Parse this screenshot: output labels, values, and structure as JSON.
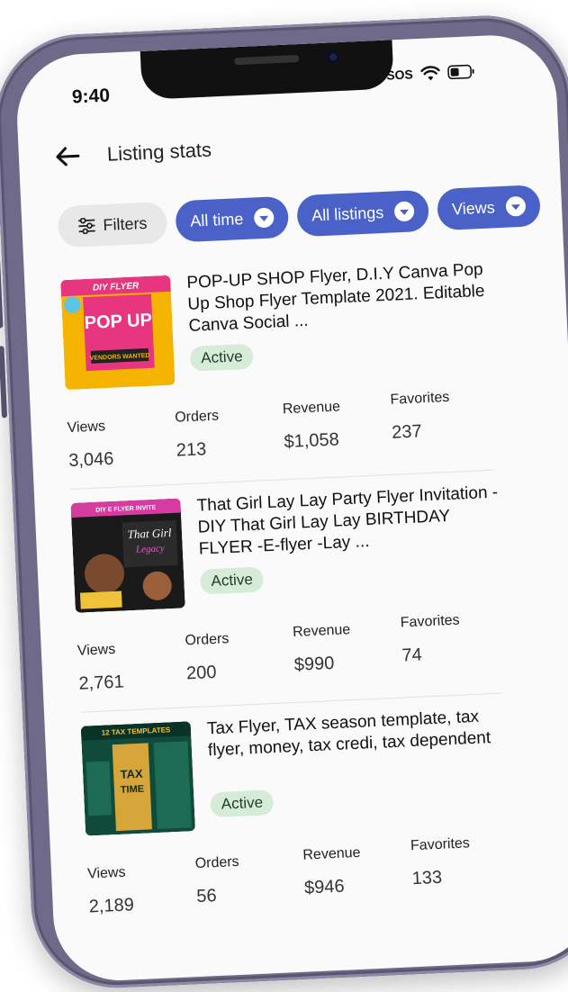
{
  "status_bar": {
    "time": "9:40",
    "carrier": "SOS"
  },
  "header": {
    "title": "Listing stats"
  },
  "chips": {
    "filters": "Filters",
    "time_range": "All time",
    "listings": "All listings",
    "views": "Views"
  },
  "listings": [
    {
      "title": "POP-UP SHOP Flyer, D.I.Y Canva Pop Up Shop Flyer Template 2021. Editable Canva Social ...",
      "status": "Active",
      "stats": {
        "views_label": "Views",
        "views": "3,046",
        "orders_label": "Orders",
        "orders": "213",
        "revenue_label": "Revenue",
        "revenue": "$1,058",
        "favorites_label": "Favorites",
        "favorites": "237"
      },
      "thumb_text": {
        "top": "DIY FLYER",
        "main": "POP UP",
        "sub": "VENDORS WANTED"
      }
    },
    {
      "title": "That Girl Lay Lay Party Flyer Invitation -DIY That Girl Lay Lay BIRTHDAY FLYER -E-flyer -Lay ...",
      "status": "Active",
      "stats": {
        "views_label": "Views",
        "views": "2,761",
        "orders_label": "Orders",
        "orders": "200",
        "revenue_label": "Revenue",
        "revenue": "$990",
        "favorites_label": "Favorites",
        "favorites": "74"
      },
      "thumb_text": {
        "top": "DIY E FLYER INVITE",
        "main": "That Girl",
        "sub": "Legacy"
      }
    },
    {
      "title": "Tax Flyer, TAX season template, tax flyer, money, tax credi, tax dependent",
      "status": "Active",
      "stats": {
        "views_label": "Views",
        "views": "2,189",
        "orders_label": "Orders",
        "orders": "56",
        "revenue_label": "Revenue",
        "revenue": "$946",
        "favorites_label": "Favorites",
        "favorites": "133"
      },
      "thumb_text": {
        "top": "12 TAX TEMPLATES",
        "main": "TAX",
        "sub": "TIME"
      }
    }
  ],
  "colors": {
    "accent": "#4a62c8",
    "badge_bg": "#d6ecd9",
    "frame": "#6f6a8a"
  }
}
